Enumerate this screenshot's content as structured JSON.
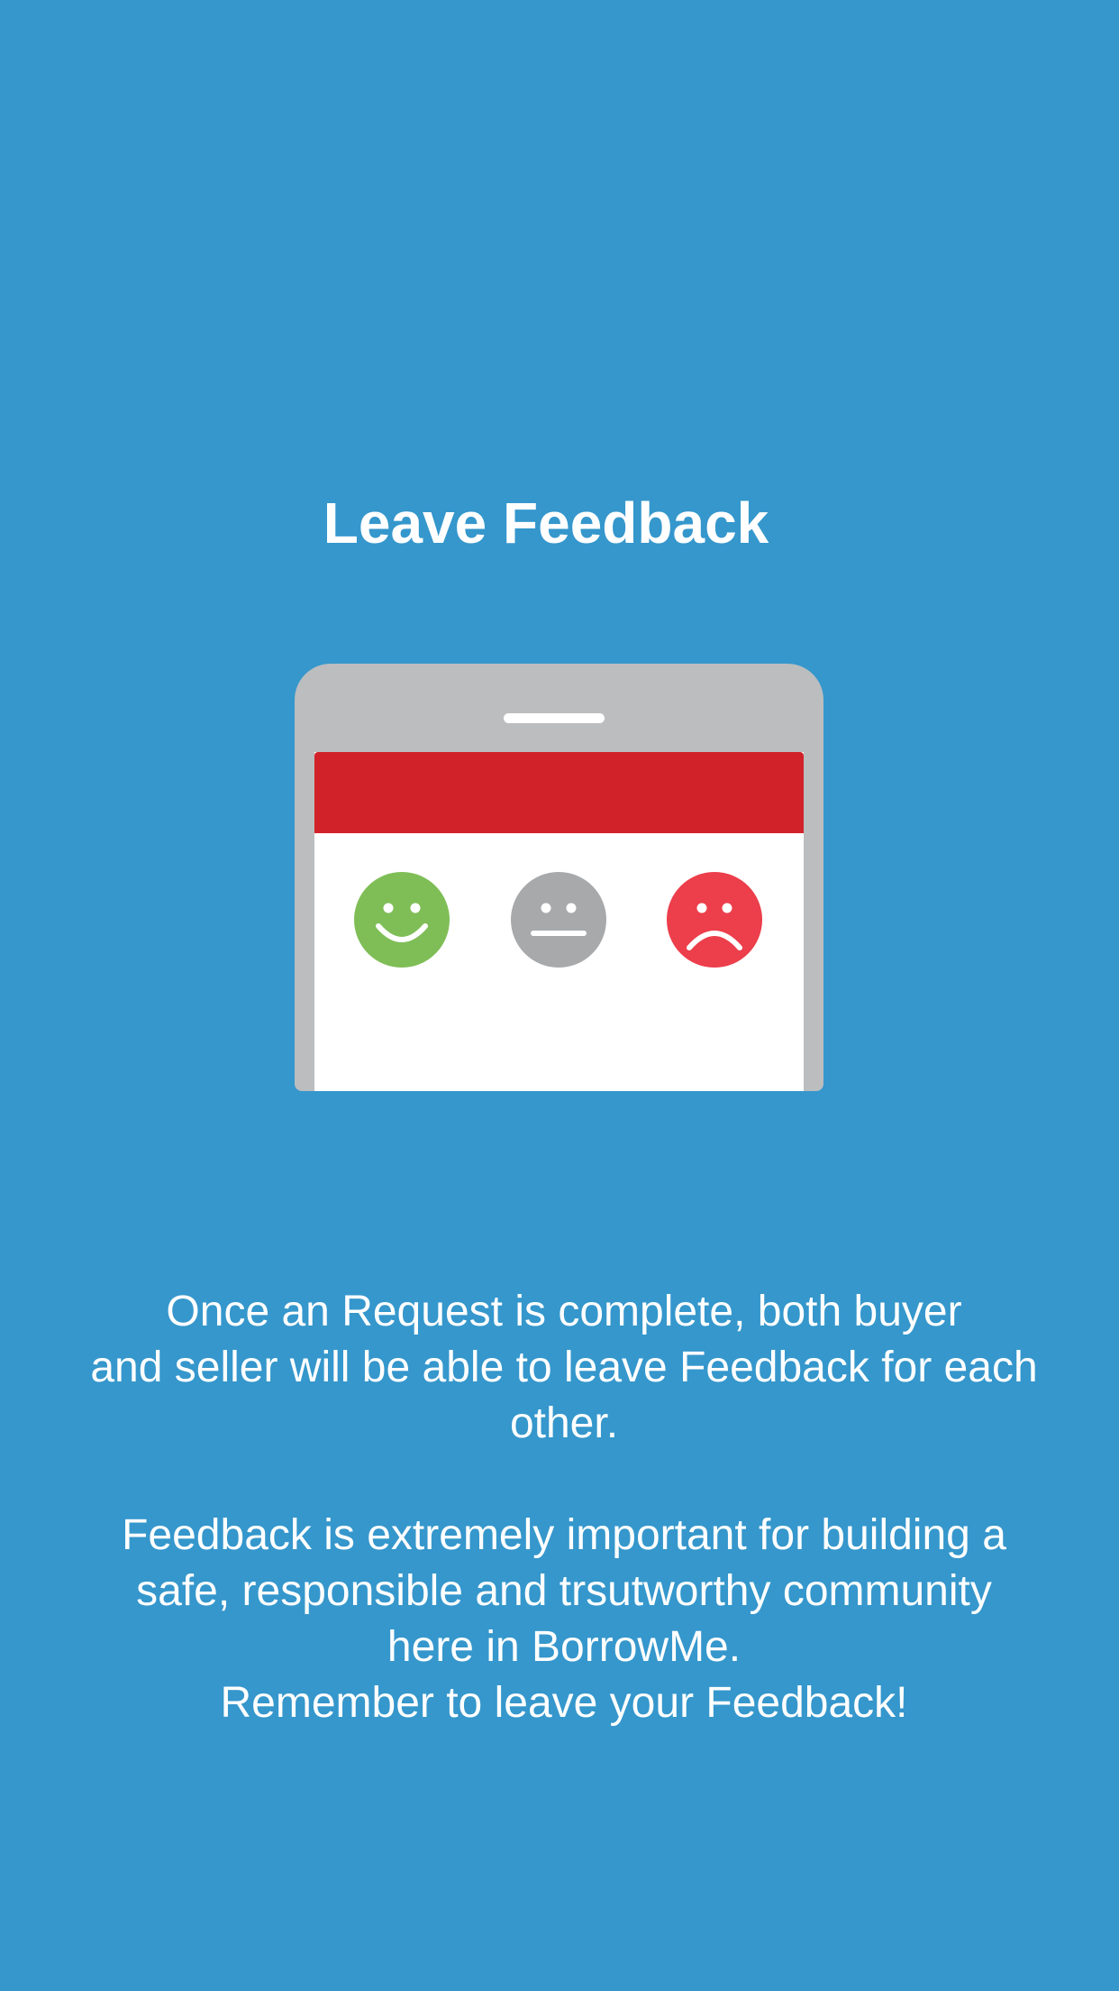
{
  "screen": {
    "title": "Leave Feedback",
    "background_color": "#3597cc"
  },
  "illustration": {
    "header_color": "#d12229",
    "faces": [
      {
        "icon": "happy-face-icon",
        "color": "#7fbe57"
      },
      {
        "icon": "neutral-face-icon",
        "color": "#a7a9ab"
      },
      {
        "icon": "sad-face-icon",
        "color": "#ec3e4b"
      }
    ]
  },
  "description": {
    "paragraph_1": {
      "line_1": "Once an Request is complete, both  buyer",
      "line_2": "and seller will be able to leave Feedback for each",
      "line_3": "other."
    },
    "paragraph_2": {
      "line_1": "Feedback is extremely important for building a",
      "line_2": "safe, responsible and trsutworthy community",
      "line_3": "here in BorrowMe."
    },
    "closing": "Remember to leave your Feedback!"
  }
}
